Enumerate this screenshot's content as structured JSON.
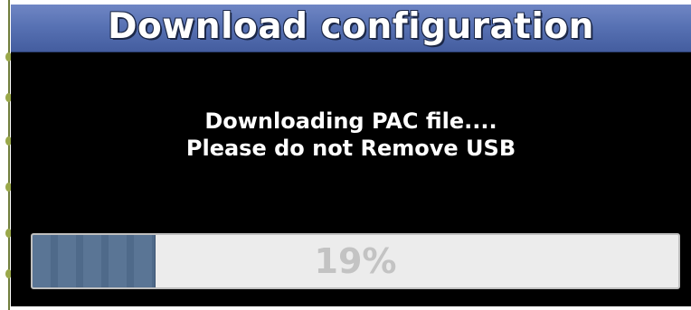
{
  "dialog": {
    "title": "Download configuration",
    "message_line1": "Downloading PAC file....",
    "message_line2": "Please do not Remove USB"
  },
  "progress": {
    "value": 0.19,
    "label": "19%"
  },
  "colors": {
    "title_bar": "#5670b2",
    "dialog_bg": "#000000",
    "progress_fill": "#5a7595",
    "progress_track": "#ececec",
    "progress_text": "#c3c3c3"
  }
}
